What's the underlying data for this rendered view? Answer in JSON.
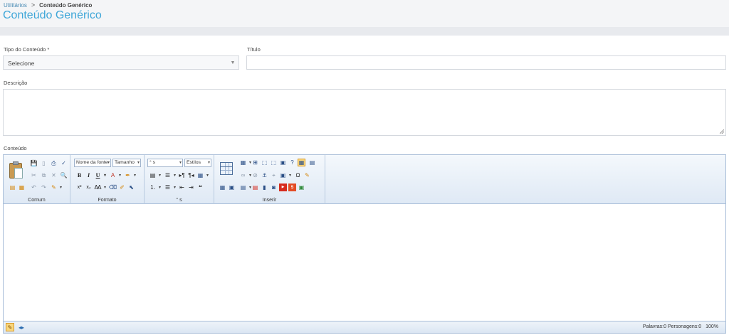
{
  "breadcrumb": {
    "parent": "Utilitários",
    "separator": ">",
    "current": "Conteúdo Genérico"
  },
  "page_title": "Conteúdo Genérico",
  "form": {
    "tipo_label": "Tipo do Conteúdo *",
    "tipo_value": "Selecione",
    "titulo_label": "Título",
    "titulo_value": "",
    "descricao_label": "Descrição",
    "descricao_value": "",
    "conteudo_label": "Conteúdo"
  },
  "editor": {
    "groups": {
      "comum": "Comum",
      "formato": "Formato",
      "paragraph": "° s",
      "inserir": "Inserir"
    },
    "font_name": "Nome da fonte",
    "font_size": "Tamanho",
    "paragraph_style": "° s",
    "styles": "Estilos",
    "status": {
      "words": "Palavras:0",
      "chars": "Personagens:0",
      "zoom": "100%"
    }
  },
  "icons": {
    "save": "save-icon",
    "new": "new-doc-icon",
    "print": "print-icon",
    "spell": "spellcheck-icon",
    "paste": "paste-icon",
    "cut": "cut-icon",
    "copy": "copy-icon",
    "delete": "delete-icon",
    "find": "find-icon",
    "undo": "undo-icon",
    "redo": "redo-icon",
    "format_painter": "format-painter-icon"
  },
  "colors": {
    "title_blue": "#3ea6d8",
    "ribbon_border": "#a8bdd8",
    "header_bg": "#f4f5f7"
  }
}
